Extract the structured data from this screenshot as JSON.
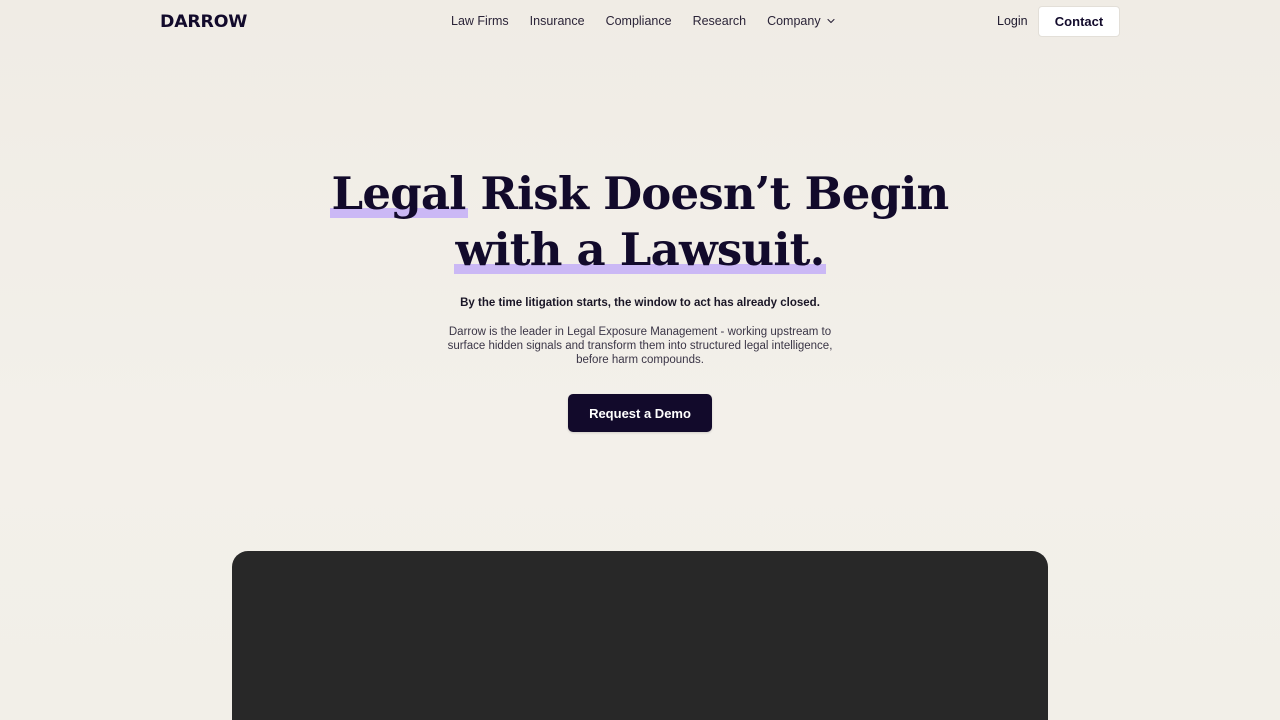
{
  "header": {
    "logo_text": "DARROW",
    "nav": [
      {
        "label": "Law Firms"
      },
      {
        "label": "Insurance"
      },
      {
        "label": "Compliance"
      },
      {
        "label": "Research"
      },
      {
        "label": "Company",
        "icon": "chevron-down-icon"
      }
    ],
    "login_label": "Login",
    "contact_label": "Contact"
  },
  "hero": {
    "title_line1_highlight": "Legal",
    "title_line1_rest": " Risk Doesn’t Begin",
    "title_line2_highlight": "with a Lawsuit.",
    "subheading": "By the time litigation starts, the window to act has already closed.",
    "description": "Darrow is the leader in Legal Exposure Management - working upstream to surface hidden signals and transform them into structured legal intelligence, before harm compounds.",
    "cta_label": "Request a Demo"
  },
  "colors": {
    "background": "#f1ede6",
    "brand_navy": "#120a2b",
    "highlight_lavender": "#cbb8f5",
    "media_panel": "#282828"
  }
}
